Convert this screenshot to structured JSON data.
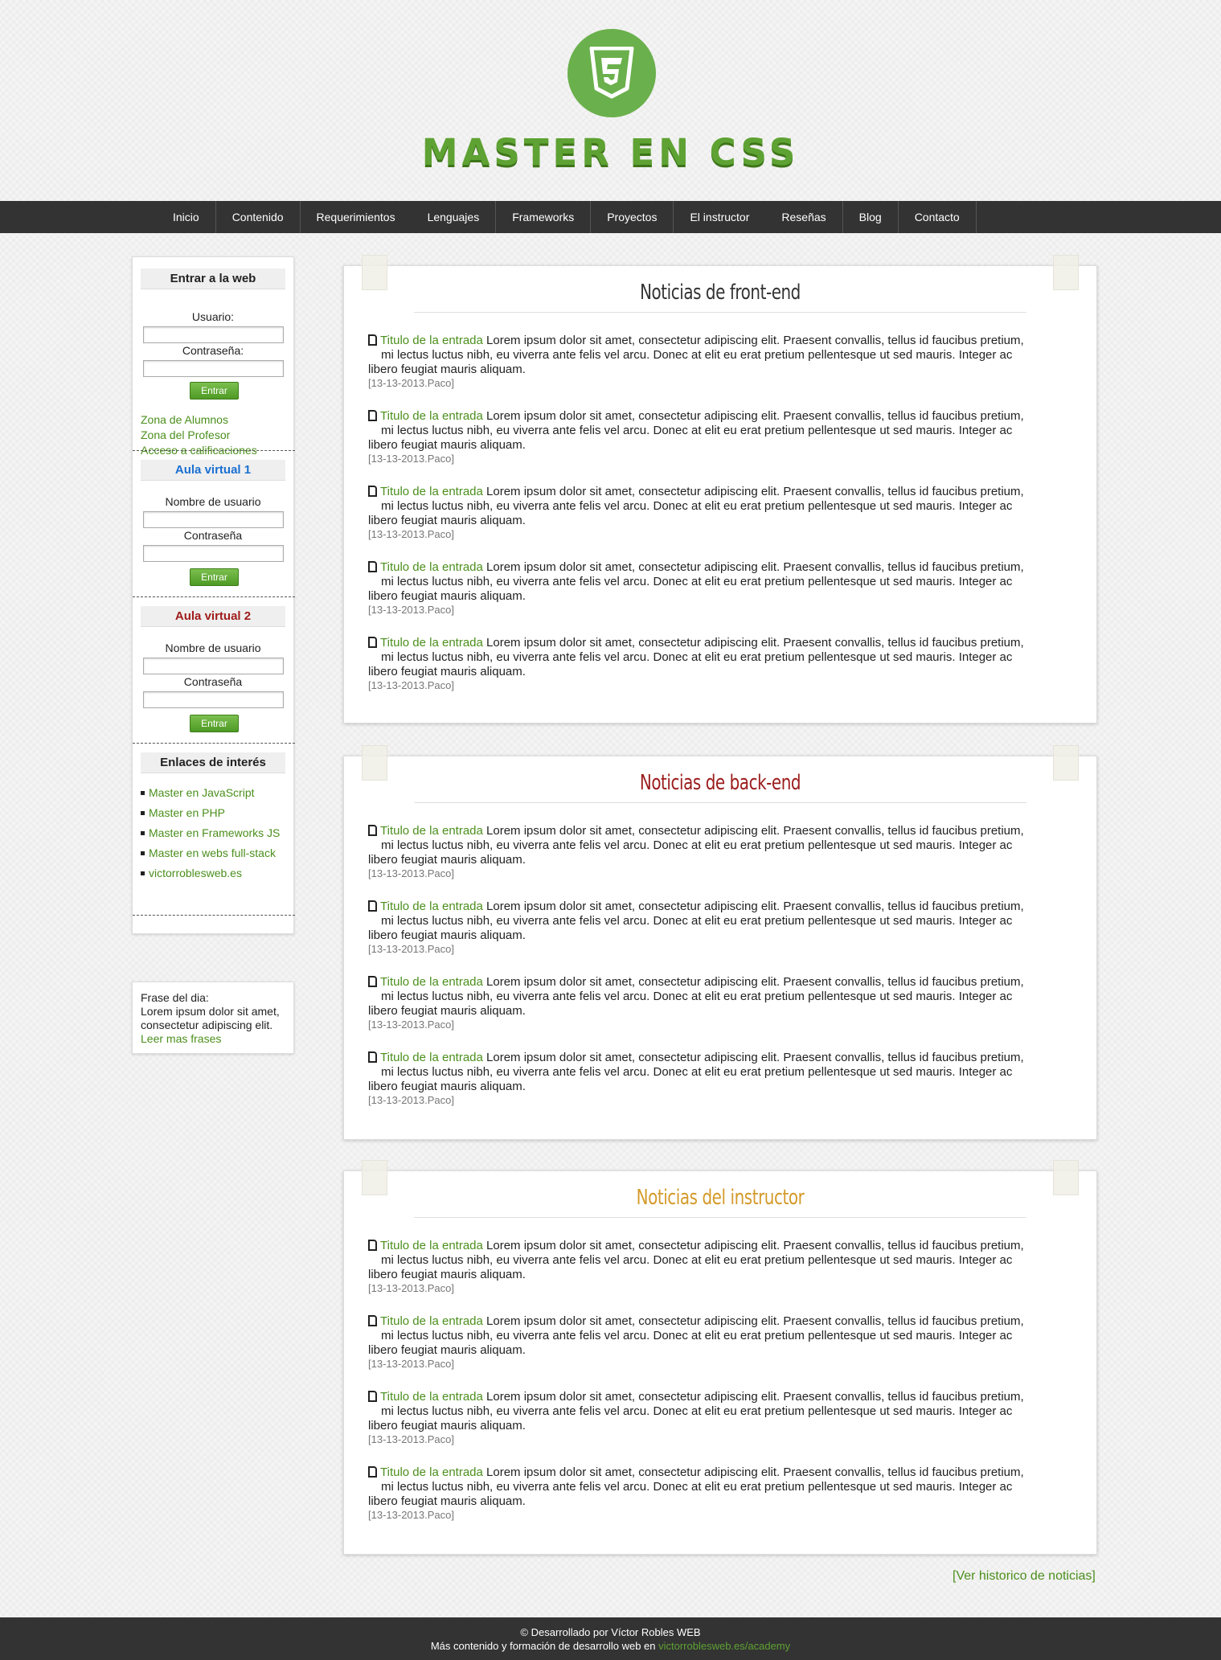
{
  "header": {
    "logo_icon": "css3-shield-icon",
    "title": "MASTER EN CSS"
  },
  "nav": {
    "items": [
      "Inicio",
      "Contenido",
      "Requerimientos",
      "Lenguajes",
      "Frameworks",
      "Proyectos",
      "El instructor",
      "Reseñas",
      "Blog",
      "Contacto"
    ]
  },
  "sidebar": {
    "login": {
      "title": "Entrar a la web",
      "user_label": "Usuario:",
      "pass_label": "Contraseña:",
      "button": "Entrar",
      "links": [
        "Zona de Alumnos",
        "Zona del Profesor",
        "Acceso a calificaciones"
      ]
    },
    "aula1": {
      "title": "Aula virtual 1",
      "title_color": "#1a6fd1",
      "user_label": "Nombre de usuario",
      "pass_label": "Contraseña",
      "button": "Entrar"
    },
    "aula2": {
      "title": "Aula virtual 2",
      "title_color": "#a01c1c",
      "user_label": "Nombre de usuario",
      "pass_label": "Contraseña",
      "button": "Entrar"
    },
    "links": {
      "title": "Enlaces de interés",
      "items": [
        "Master en JavaScript",
        "Master en PHP",
        "Master en Frameworks JS",
        "Master en webs full-stack",
        "victorroblesweb.es"
      ]
    }
  },
  "quote": {
    "label": "Frase del dia:",
    "text": "Lorem ipsum dolor sit amet, consectetur adipiscing elit.",
    "link": "Leer mas frases"
  },
  "news_text": {
    "title_link": "Titulo de la entrada",
    "line1": "Lorem ipsum dolor sit amet, consectetur adipiscing elit. Praesent convallis, tellus id faucibus pretium,",
    "line2": "mi lectus luctus nibh, eu viverra ante felis vel arcu. Donec at elit eu erat pretium pellentesque ut sed mauris. Integer ac",
    "line3": "libero feugiat mauris aliquam.",
    "meta": "[13-13-2013.Paco]"
  },
  "sections": [
    {
      "title": "Noticias de front-end",
      "color": "#333333"
    },
    {
      "title": "Noticias de back-end",
      "color": "#9b1c1c"
    },
    {
      "title": "Noticias del instructor",
      "color": "#d49a2a"
    }
  ],
  "history_link": "[Ver historico de noticias]",
  "footer": {
    "line1": "© Desarrollado por Víctor Robles WEB",
    "line2_prefix": "Más contenido y formación de desarrollo web en ",
    "line2_link": "victorroblesweb.es/academy"
  },
  "colors": {
    "accent": "#5ea233",
    "nav_bg": "#333333"
  }
}
